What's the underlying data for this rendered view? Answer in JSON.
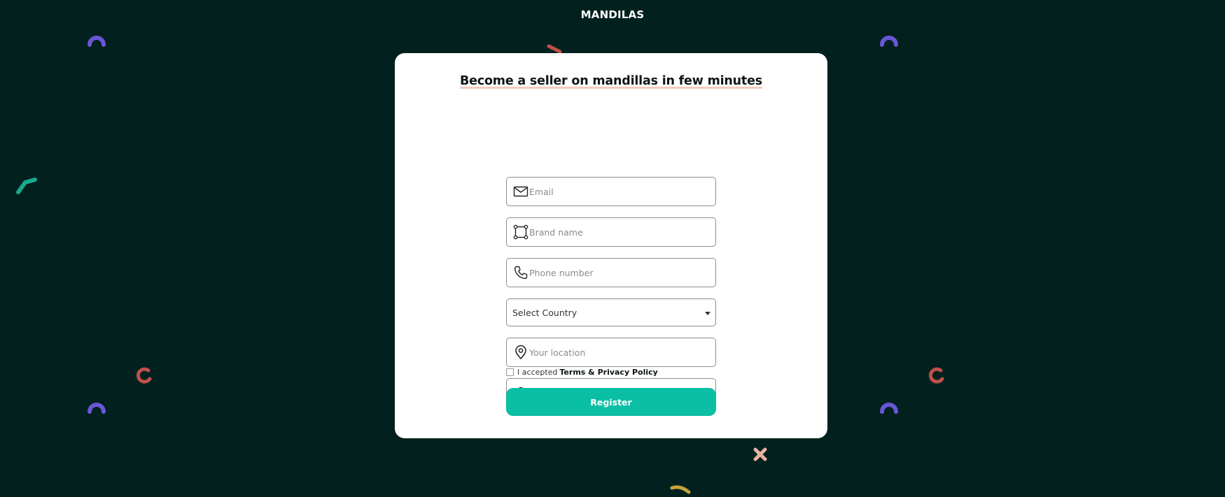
{
  "brand": {
    "name": "MANDILAS"
  },
  "form": {
    "heading": "Become a seller on mandillas in few minutes",
    "email": {
      "placeholder": "Email",
      "icon": "mail-icon"
    },
    "brand_name": {
      "placeholder": "Brand name",
      "icon": "frame-icon"
    },
    "phone": {
      "placeholder": "Phone number",
      "icon": "phone-icon"
    },
    "country": {
      "selected": "Select Country"
    },
    "location": {
      "placeholder": "Your location",
      "icon": "location-pin-icon"
    },
    "password": {
      "value": "••••••••",
      "icon": "lock-icon",
      "toggle_icon": "eye-icon"
    },
    "consent": {
      "prefix": "I accepted",
      "link": "Terms & Privacy Policy",
      "checked": false
    },
    "submit_label": "Register"
  },
  "colors": {
    "background": "#02211e",
    "card": "#ffffff",
    "accent": "#0bbfa4",
    "heading_underline": "#f2cbbd"
  }
}
